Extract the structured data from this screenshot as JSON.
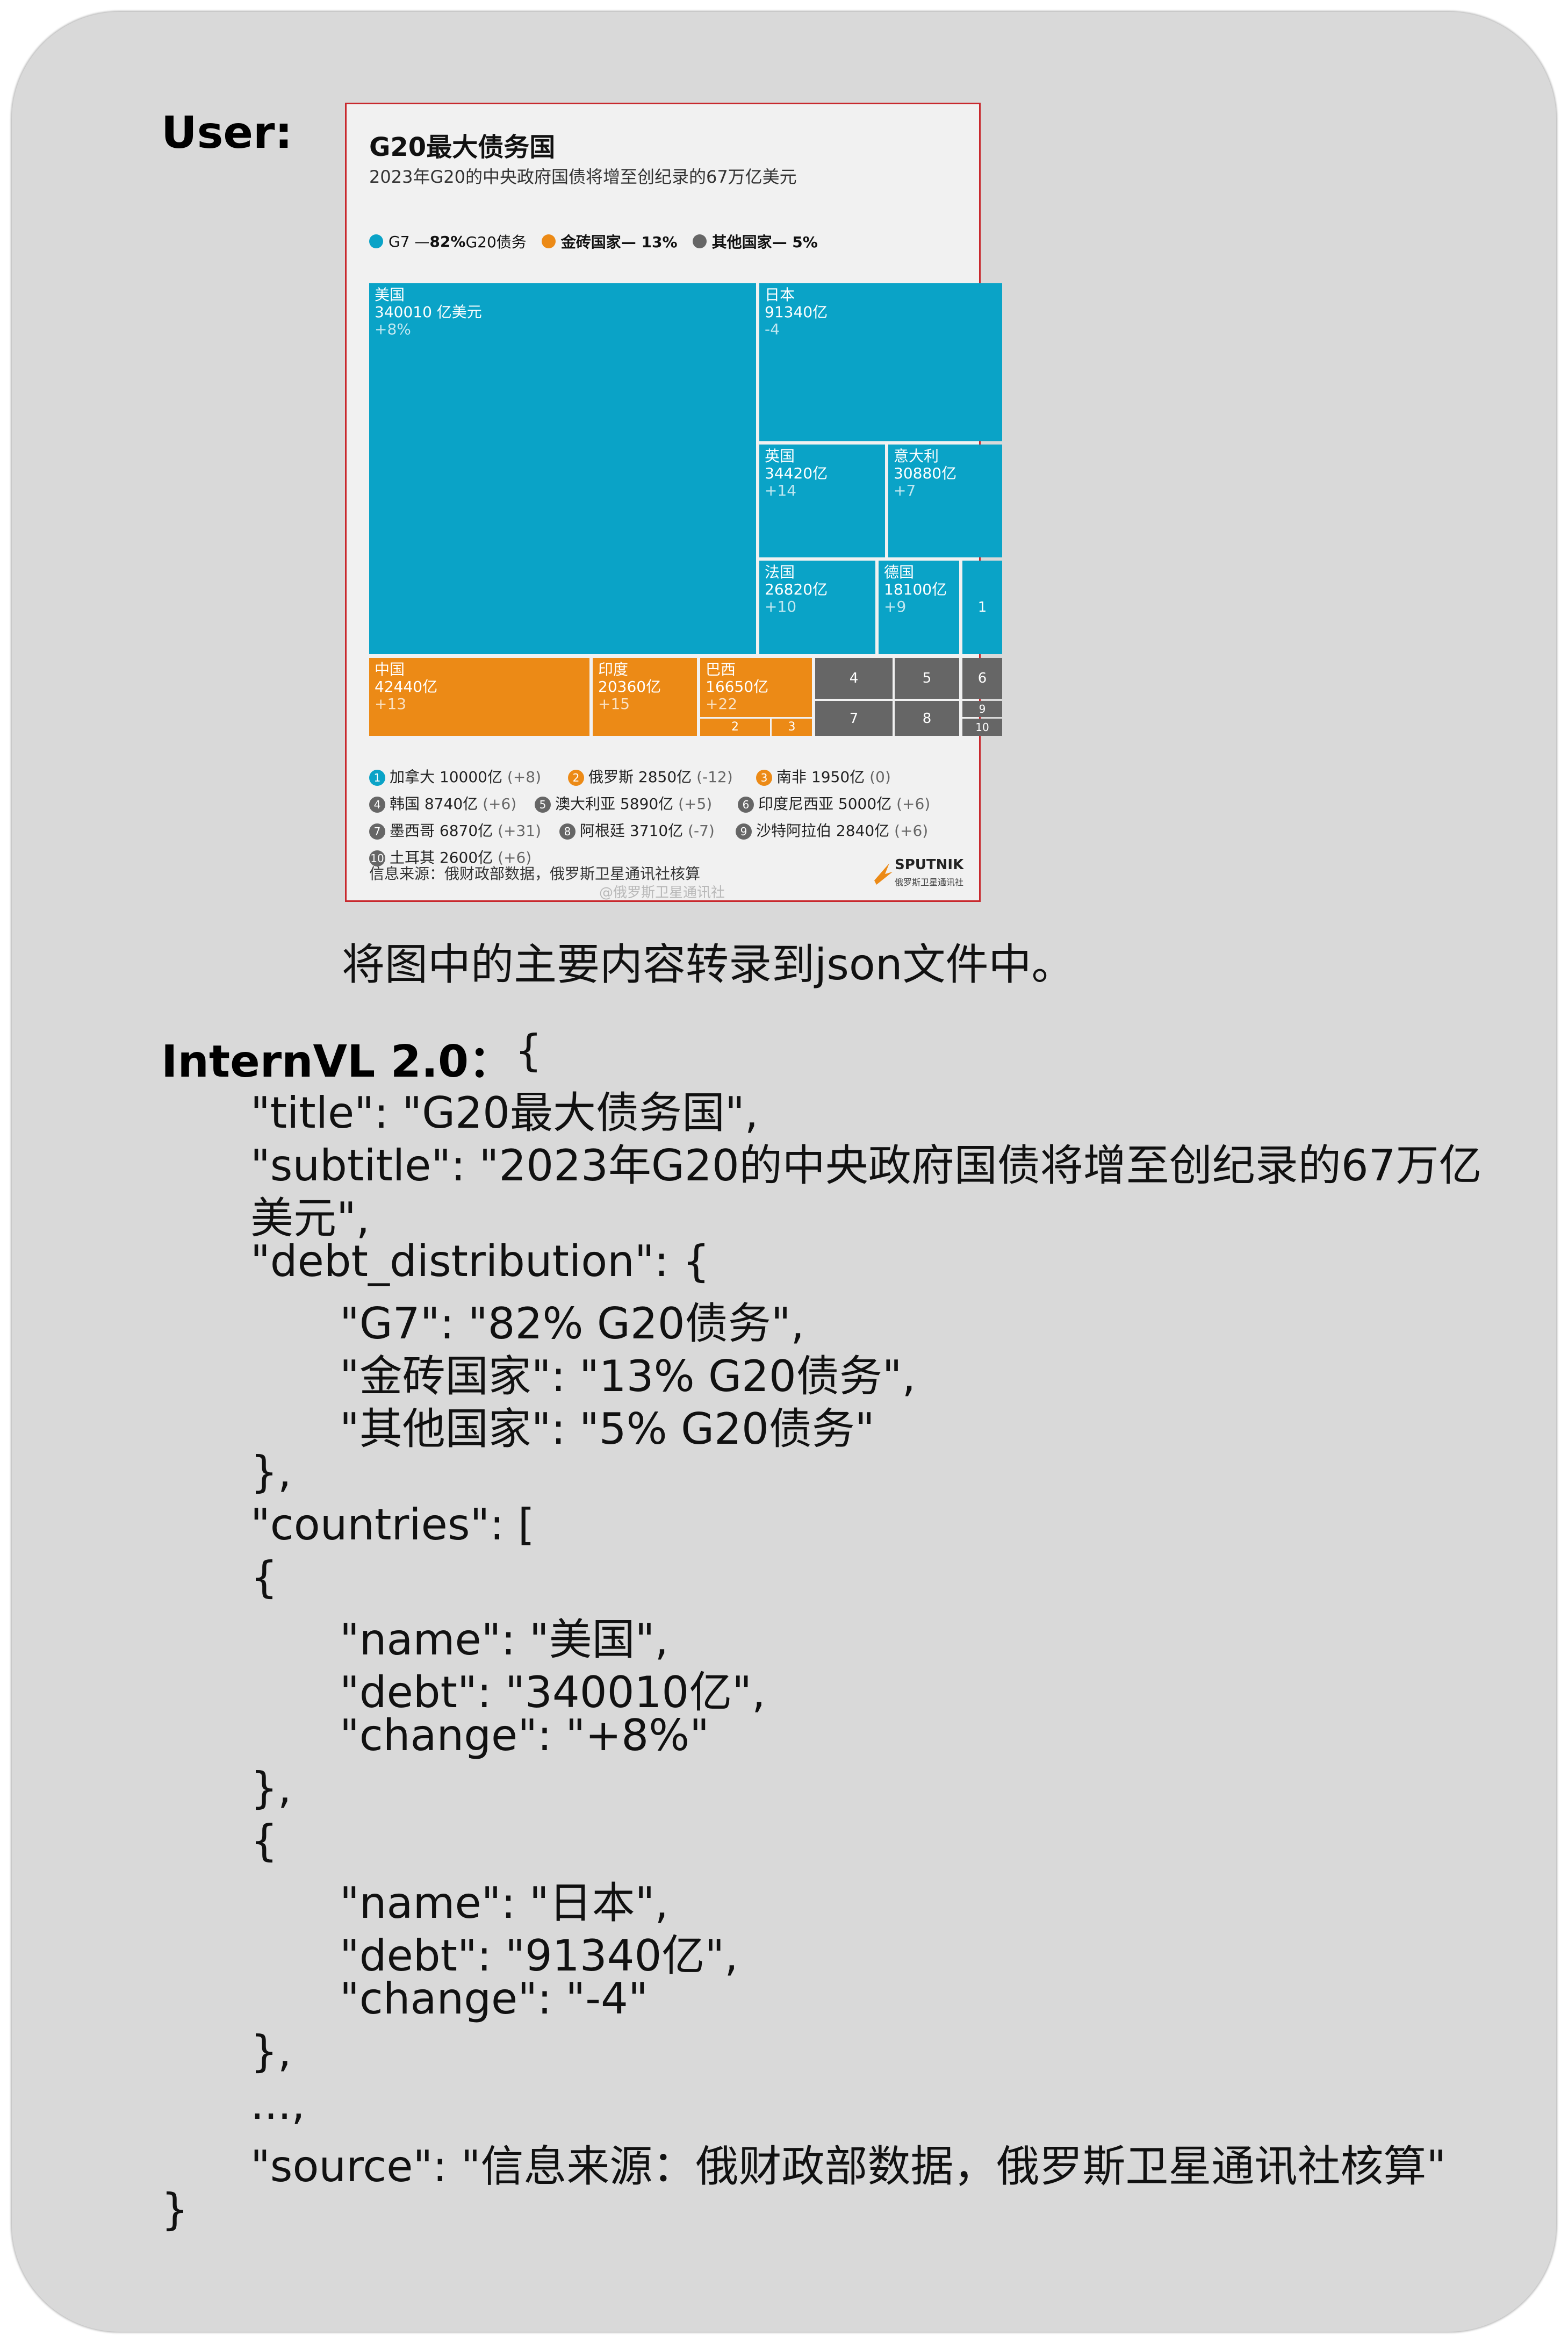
{
  "labels": {
    "user": "User:",
    "assistant": "InternVL 2.0："
  },
  "infographic": {
    "title": "G20最大债务国",
    "subtitle": "2023年G20的中央政府国债将增至创纪录的67万亿美元",
    "legend": {
      "g7_label": "G7 — ",
      "g7_pct": "82%",
      "g7_tail": "G20债务",
      "g7_color": "#0aa3c7",
      "brics_label": "金砖国家— 13%",
      "brics_color": "#ec8a16",
      "other_label": "其他国家— 5%",
      "other_color": "#666666"
    },
    "cells": {
      "us": {
        "name": "美国",
        "value": "340010 亿美元",
        "change": "+8%"
      },
      "jp": {
        "name": "日本",
        "value": "91340亿",
        "change": "-4"
      },
      "uk": {
        "name": "英国",
        "value": "34420亿",
        "change": "+14"
      },
      "it": {
        "name": "意大利",
        "value": "30880亿",
        "change": "+7"
      },
      "fr": {
        "name": "法国",
        "value": "26820亿",
        "change": "+10"
      },
      "de": {
        "name": "德国",
        "value": "18100亿",
        "change": "+9"
      },
      "n1": "1",
      "cn": {
        "name": "中国",
        "value": "42440亿",
        "change": "+13"
      },
      "in": {
        "name": "印度",
        "value": "20360亿",
        "change": "+15"
      },
      "br": {
        "name": "巴西",
        "value": "16650亿",
        "change": "+22"
      },
      "n2": "2",
      "n3": "3",
      "n4": "4",
      "n5": "5",
      "n6": "6",
      "n7": "7",
      "n8": "8",
      "n9": "9",
      "n10": "10"
    },
    "footnotes": [
      {
        "num": "1",
        "name": "加拿大 10000亿",
        "change": "(+8)",
        "color": "#0aa3c7"
      },
      {
        "num": "2",
        "name": "俄罗斯 2850亿",
        "change": "(-12)",
        "color": "#ec8a16"
      },
      {
        "num": "3",
        "name": "南非 1950亿",
        "change": "(0)",
        "color": "#ec8a16"
      },
      {
        "num": "4",
        "name": "韩国 8740亿",
        "change": "(+6)",
        "color": "#666666"
      },
      {
        "num": "5",
        "name": "澳大利亚 5890亿",
        "change": "(+5)",
        "color": "#666666"
      },
      {
        "num": "6",
        "name": "印度尼西亚 5000亿",
        "change": "(+6)",
        "color": "#666666"
      },
      {
        "num": "7",
        "name": "墨西哥 6870亿",
        "change": "(+31)",
        "color": "#666666"
      },
      {
        "num": "8",
        "name": "阿根廷 3710亿",
        "change": "(-7)",
        "color": "#666666"
      },
      {
        "num": "9",
        "name": "沙特阿拉伯 2840亿",
        "change": "(+6)",
        "color": "#666666"
      },
      {
        "num": "10",
        "name": "土耳其 2600亿",
        "change": "(+6)",
        "color": "#666666"
      }
    ],
    "source": "信息来源：俄财政部数据，俄罗斯卫星通讯社核算",
    "watermark": "@俄罗斯卫星通讯社",
    "logo_text": "SPUTNIK",
    "logo_sub": "俄罗斯卫星通讯社"
  },
  "prompt": "将图中的主要内容转录到json文件中。",
  "response_lines": [
    "{",
    "\"title\": \"G20最大债务国\",",
    "\"subtitle\": \"2023年G20的中央政府国债将增至创纪录的67万亿",
    "美元\",",
    "\"debt_distribution\": {",
    "\"G7\": \"82% G20债务\",",
    "\"金砖国家\": \"13% G20债务\",",
    "\"其他国家\": \"5% G20债务\"",
    "},",
    "\"countries\": [",
    "{",
    "\"name\": \"美国\",",
    "\"debt\": \"340010亿\",",
    "\"change\": \"+8%\"",
    "},",
    "{",
    "\"name\": \"日本\",",
    "\"debt\": \"91340亿\",",
    "\"change\": \"-4\"",
    "},",
    "...,",
    "\"source\": \"信息来源：俄财政部数据，俄罗斯卫星通讯社核算\"",
    "}"
  ]
}
